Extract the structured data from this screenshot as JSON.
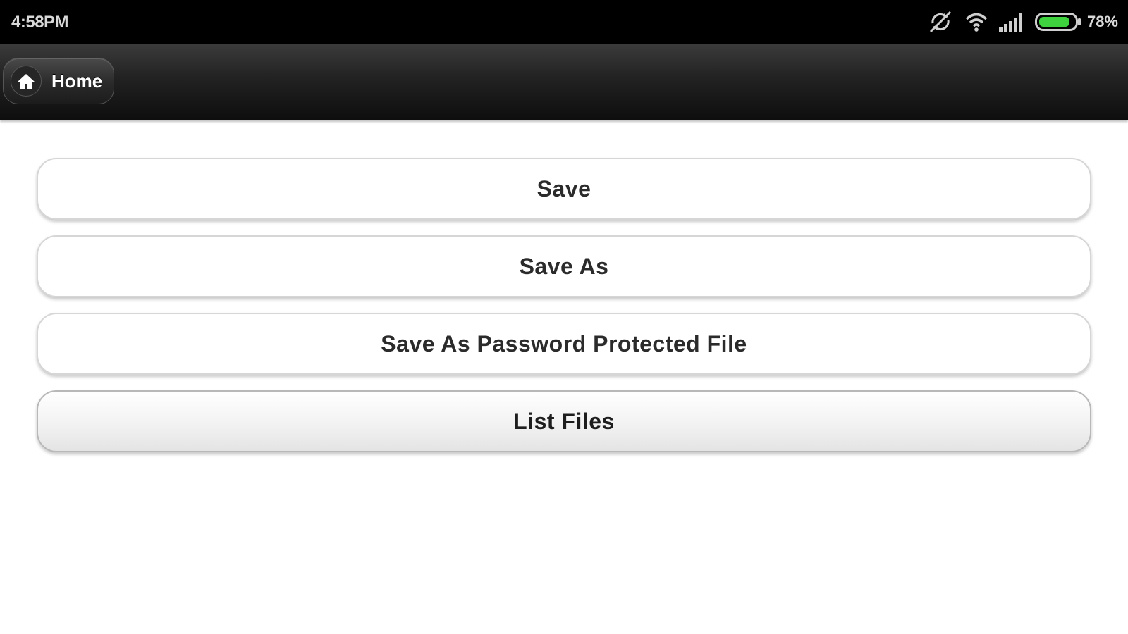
{
  "status_bar": {
    "time": "4:58PM",
    "battery_percent": "78%",
    "battery_level": 0.78,
    "icons": [
      "sync-off-icon",
      "wifi-icon",
      "signal-icon",
      "battery-icon"
    ],
    "colors": {
      "background": "#000000",
      "battery": "#3fd23f"
    }
  },
  "toolbar": {
    "home_label": "Home",
    "home_icon": "home-icon"
  },
  "menu": {
    "items": [
      {
        "label": "Save"
      },
      {
        "label": "Save As"
      },
      {
        "label": "Save As Password Protected File"
      },
      {
        "label": "List Files"
      }
    ]
  }
}
